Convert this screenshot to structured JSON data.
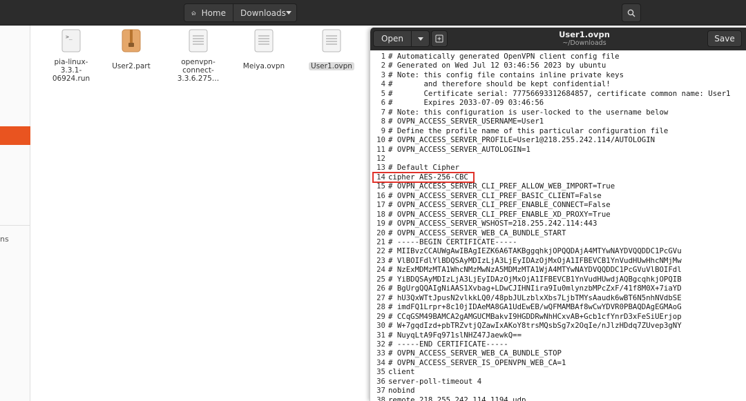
{
  "file_manager": {
    "path": {
      "home_label": "Home",
      "current_label": "Downloads"
    },
    "sidebar_fragment": "ns",
    "files": [
      {
        "name": "pia-linux-\n3.3.1-\n06924.run",
        "icon": "terminal-script-icon",
        "selected": false
      },
      {
        "name": "User2.part",
        "icon": "archive-icon",
        "selected": false
      },
      {
        "name": "openvpn-\nconnect-\n3.3.6.275…",
        "icon": "text-file-icon",
        "selected": false
      },
      {
        "name": "Meiya.ovpn",
        "icon": "text-file-icon",
        "selected": false
      },
      {
        "name": "User1.ovpn",
        "icon": "text-file-icon",
        "selected": true
      }
    ]
  },
  "editor": {
    "open_label": "Open",
    "save_label": "Save",
    "title": "User1.ovpn",
    "subtitle": "~/Downloads",
    "highlighted_line": 14,
    "lines": [
      {
        "n": "1",
        "t": "# Automatically generated OpenVPN client config file"
      },
      {
        "n": "2",
        "t": "# Generated on Wed Jul 12 03:46:56 2023 by ubuntu"
      },
      {
        "n": "3",
        "t": "# Note: this config file contains inline private keys"
      },
      {
        "n": "4",
        "t": "#       and therefore should be kept confidential!"
      },
      {
        "n": "5",
        "t": "#       Certificate serial: 77756693312684857, certificate common name: User1"
      },
      {
        "n": "6",
        "t": "#       Expires 2033-07-09 03:46:56"
      },
      {
        "n": "7",
        "t": "# Note: this configuration is user-locked to the username below"
      },
      {
        "n": "8",
        "t": "# OVPN_ACCESS_SERVER_USERNAME=User1"
      },
      {
        "n": "9",
        "t": "# Define the profile name of this particular configuration file"
      },
      {
        "n": "10",
        "t": "# OVPN_ACCESS_SERVER_PROFILE=User1@218.255.242.114/AUTOLOGIN"
      },
      {
        "n": "11",
        "t": "# OVPN_ACCESS_SERVER_AUTOLOGIN=1"
      },
      {
        "n": "12",
        "t": ""
      },
      {
        "n": "13",
        "t": "# Default Cipher"
      },
      {
        "n": "14",
        "t": "cipher AES-256-CBC"
      },
      {
        "n": "15",
        "t": "# OVPN_ACCESS_SERVER_CLI_PREF_ALLOW_WEB_IMPORT=True"
      },
      {
        "n": "16",
        "t": "# OVPN_ACCESS_SERVER_CLI_PREF_BASIC_CLIENT=False"
      },
      {
        "n": "17",
        "t": "# OVPN_ACCESS_SERVER_CLI_PREF_ENABLE_CONNECT=False"
      },
      {
        "n": "18",
        "t": "# OVPN_ACCESS_SERVER_CLI_PREF_ENABLE_XD_PROXY=True"
      },
      {
        "n": "19",
        "t": "# OVPN_ACCESS_SERVER_WSHOST=218.255.242.114:443"
      },
      {
        "n": "20",
        "t": "# OVPN_ACCESS_SERVER_WEB_CA_BUNDLE_START"
      },
      {
        "n": "21",
        "t": "# -----BEGIN CERTIFICATE-----"
      },
      {
        "n": "22",
        "t": "# MIIBvzCCAUWgAwIBAgIEZK6A6TAKBggqhkjOPQQDAjA4MTYwNAYDVQQDDC1PcGVu"
      },
      {
        "n": "23",
        "t": "# VlBOIFdlYlBDQSAyMDIzLjA3LjEyIDAzOjMxOjA1IFBEVCB1YnVudHUwHhcNMjMw"
      },
      {
        "n": "24",
        "t": "# NzExMDMzMTA1WhcNMzMwNzA5MDMzMTA1WjA4MTYwNAYDVQQDDC1PcGVuVlBOIFdl"
      },
      {
        "n": "25",
        "t": "# YiBDQSAyMDIzLjA3LjEyIDAzOjMxOjA1IFBEVCB1YnVudHUwdjAQBgcqhkjOPQIB"
      },
      {
        "n": "26",
        "t": "# BgUrgQQAIgNiAAS1Xvbag+LDwCJIHNIira9Iu0mlynzbMPcZxF/41f8M0X+7iaYD"
      },
      {
        "n": "27",
        "t": "# hU3QxWTtJpusN2vlkkLQ0/48pbJULzblxXbs7LjbTMYsAaudk6wBT6N5nhNVdbSE"
      },
      {
        "n": "28",
        "t": "# imdFQ1Lrpr+8c10jIDAeMA8GA1UdEwEB/wQFMAMBAf8wCwYDVR0PBAQDAgEGMAoG"
      },
      {
        "n": "29",
        "t": "# CCqGSM49BAMCA2gAMGUCMBakvI9HGDDRwNhHCxvAB+Gcb1cfYnrD3xFeSiUErjop"
      },
      {
        "n": "30",
        "t": "# W+7gqdIzd+pbTRZvtjQZawIxAKoY8trsMQsbSg7x2OqIe/nJlzHDdq7ZUvep3gNY"
      },
      {
        "n": "31",
        "t": "# NuyqLtA9Fq971slNHZ47JaewkQ=="
      },
      {
        "n": "32",
        "t": "# -----END CERTIFICATE-----"
      },
      {
        "n": "33",
        "t": "# OVPN_ACCESS_SERVER_WEB_CA_BUNDLE_STOP"
      },
      {
        "n": "34",
        "t": "# OVPN_ACCESS_SERVER_IS_OPENVPN_WEB_CA=1"
      },
      {
        "n": "35",
        "t": "client"
      },
      {
        "n": "36",
        "t": "server-poll-timeout 4"
      },
      {
        "n": "37",
        "t": "nobind"
      },
      {
        "n": "38",
        "t": "remote 218.255.242.114 1194 udp"
      }
    ]
  },
  "colors": {
    "accent": "#e95420",
    "highlight_box": "#e0322a",
    "header_bg": "#2c2c2c"
  }
}
